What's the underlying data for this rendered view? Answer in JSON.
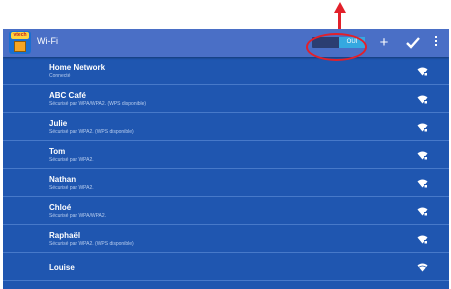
{
  "app": {
    "title": "Wi-Fi",
    "logo_text": "vtech"
  },
  "toolbar": {
    "toggle_label": "OUI",
    "add_icon": "plus-icon",
    "confirm_icon": "check-icon",
    "menu_icon": "overflow-menu-icon"
  },
  "networks": [
    {
      "name": "Home Network",
      "status": "Connecté"
    },
    {
      "name": "ABC Café",
      "status": "Sécurisé par WPA/WPA2. (WPS disponible)"
    },
    {
      "name": "Julie",
      "status": "Sécurisé par WPA2. (WPS disponible)"
    },
    {
      "name": "Tom",
      "status": "Sécurisé par WPA2."
    },
    {
      "name": "Nathan",
      "status": "Sécurisé par WPA2."
    },
    {
      "name": "Chloé",
      "status": "Sécurisé par WPA/WPA2."
    },
    {
      "name": "Raphaël",
      "status": "Sécurisé par WPA2. (WPS disponible)"
    },
    {
      "name": "Louise",
      "status": ""
    }
  ],
  "colors": {
    "screen_bg": "#1f56b0",
    "topbar_bg": "#4a6fc6",
    "toggle_on": "#35a8e0",
    "annotation": "#e2202a"
  }
}
